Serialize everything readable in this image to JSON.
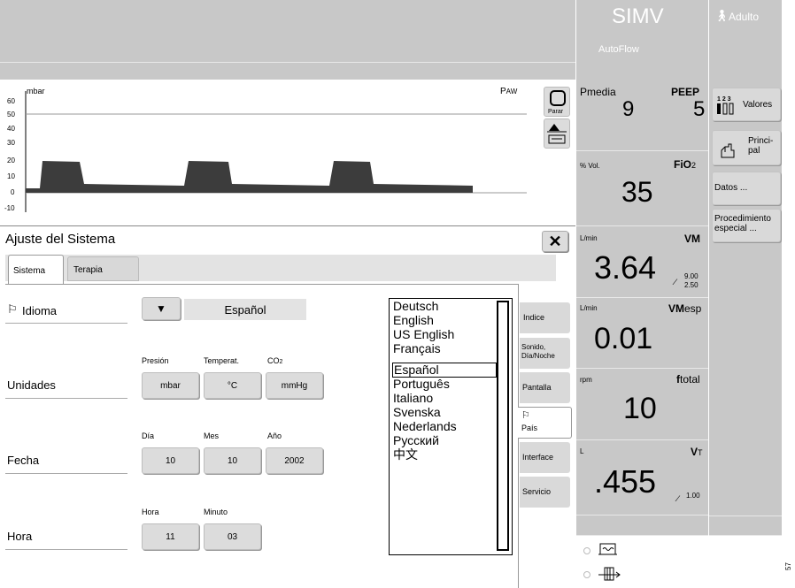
{
  "header": {
    "mode": "SIMV",
    "submode": "AutoFlow",
    "patient": "Adulto"
  },
  "waveform": {
    "unit": "mbar",
    "label": "PAW",
    "y_ticks": [
      "60",
      "50",
      "40",
      "30",
      "20",
      "10",
      "0",
      "-10"
    ],
    "stop_label": "Parar"
  },
  "params": {
    "pmedia": {
      "label": "Pmedia",
      "value": "9"
    },
    "peep": {
      "label": "PEEP",
      "value": "5"
    },
    "fio2": {
      "unit": "% Vol.",
      "label": "FiO2",
      "value": "35"
    },
    "vm": {
      "unit": "L/min",
      "label": "VM",
      "value": "3.64",
      "upper": "9.00",
      "lower": "2.50"
    },
    "vmesp": {
      "unit": "L/min",
      "label": "VMesp",
      "value": "0.01"
    },
    "ftotal": {
      "unit": "rpm",
      "label": "ftotal",
      "value": "10"
    },
    "vt": {
      "unit": "L",
      "label": "VT",
      "value": ".455",
      "limit": "1.00"
    }
  },
  "sidebar": {
    "valores": "Valores",
    "principal": "Princi-\npal",
    "datos": "Datos ...",
    "procedimiento": "Procedimiento\nespecial ..."
  },
  "dialog": {
    "title": "Ajuste del Sistema",
    "tabs": [
      "Sistema",
      "Terapia"
    ],
    "idioma": {
      "label": "Idioma",
      "value": "Español"
    },
    "unidades": {
      "label": "Unidades",
      "headers": [
        "Presión",
        "Temperat.",
        "CO2"
      ],
      "values": [
        "mbar",
        "°C",
        "mmHg"
      ]
    },
    "fecha": {
      "label": "Fecha",
      "headers": [
        "Día",
        "Mes",
        "Año"
      ],
      "values": [
        "10",
        "10",
        "2002"
      ]
    },
    "hora": {
      "label": "Hora",
      "headers": [
        "Hora",
        "Minuto"
      ],
      "values": [
        "11",
        "03"
      ]
    },
    "languages": [
      "Deutsch",
      "English",
      "US English",
      "Français",
      "Español",
      "Português",
      "Italiano",
      "Svenska",
      "Nederlands",
      "Русский",
      "中文"
    ],
    "selected_language": "Español",
    "sidetabs": [
      "Indice",
      "Sonido,\nDía/Noche",
      "Pantalla",
      "País",
      "Interface",
      "Servicio"
    ]
  },
  "figure_number": "57"
}
